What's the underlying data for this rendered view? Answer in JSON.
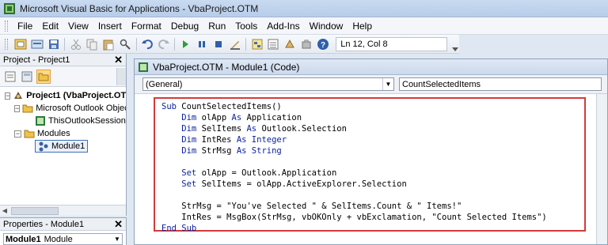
{
  "window": {
    "title": "Microsoft Visual Basic for Applications - VbaProject.OTM"
  },
  "menu": [
    "File",
    "Edit",
    "View",
    "Insert",
    "Format",
    "Debug",
    "Run",
    "Tools",
    "Add-Ins",
    "Window",
    "Help"
  ],
  "toolbar": {
    "status": "Ln 12, Col 8",
    "icons": [
      "view-excel-icon",
      "insert-module-icon",
      "save-icon",
      "cut-icon",
      "copy-icon",
      "paste-icon",
      "find-icon",
      "undo-icon",
      "redo-icon",
      "run-icon",
      "break-icon",
      "reset-icon",
      "design-mode-icon",
      "project-explorer-icon",
      "properties-icon",
      "object-browser-icon",
      "toolbox-icon",
      "help-icon"
    ]
  },
  "project_panel": {
    "title": "Project - Project1",
    "tree": {
      "root": "Project1 (VbaProject.OTM)",
      "outlook_folder": "Microsoft Outlook Objects",
      "session": "ThisOutlookSession",
      "modules_folder": "Modules",
      "module": "Module1"
    }
  },
  "properties_panel": {
    "title": "Properties - Module1",
    "object_name": "Module1",
    "object_type": "Module"
  },
  "code_window": {
    "title": "VbaProject.OTM - Module1 (Code)",
    "object_dropdown": "(General)",
    "procedure_dropdown": "CountSelectedItems",
    "lines": [
      [
        {
          "kw": true,
          "t": "Sub "
        },
        {
          "kw": false,
          "t": "CountSelectedItems()"
        }
      ],
      [
        {
          "kw": true,
          "t": "    Dim "
        },
        {
          "kw": false,
          "t": "olApp "
        },
        {
          "kw": true,
          "t": "As "
        },
        {
          "kw": false,
          "t": "Application"
        }
      ],
      [
        {
          "kw": true,
          "t": "    Dim "
        },
        {
          "kw": false,
          "t": "SelItems "
        },
        {
          "kw": true,
          "t": "As "
        },
        {
          "kw": false,
          "t": "Outlook.Selection"
        }
      ],
      [
        {
          "kw": true,
          "t": "    Dim "
        },
        {
          "kw": false,
          "t": "IntRes "
        },
        {
          "kw": true,
          "t": "As Integer"
        }
      ],
      [
        {
          "kw": true,
          "t": "    Dim "
        },
        {
          "kw": false,
          "t": "StrMsg "
        },
        {
          "kw": true,
          "t": "As String"
        }
      ],
      [
        {
          "kw": false,
          "t": ""
        }
      ],
      [
        {
          "kw": true,
          "t": "    Set "
        },
        {
          "kw": false,
          "t": "olApp = Outlook.Application"
        }
      ],
      [
        {
          "kw": true,
          "t": "    Set "
        },
        {
          "kw": false,
          "t": "SelItems = olApp.ActiveExplorer.Selection"
        }
      ],
      [
        {
          "kw": false,
          "t": ""
        }
      ],
      [
        {
          "kw": false,
          "t": "    StrMsg = \"You've Selected \" & SelItems.Count & \" Items!\""
        }
      ],
      [
        {
          "kw": false,
          "t": "    IntRes = MsgBox(StrMsg, vbOKOnly + vbExclamation, \"Count Selected Items\")"
        }
      ],
      [
        {
          "kw": true,
          "t": "End Sub"
        }
      ]
    ]
  },
  "colors": {
    "keyword": "#0a1f9e",
    "highlight_border": "#d23a3a",
    "selection_border": "#3f6fb5"
  }
}
